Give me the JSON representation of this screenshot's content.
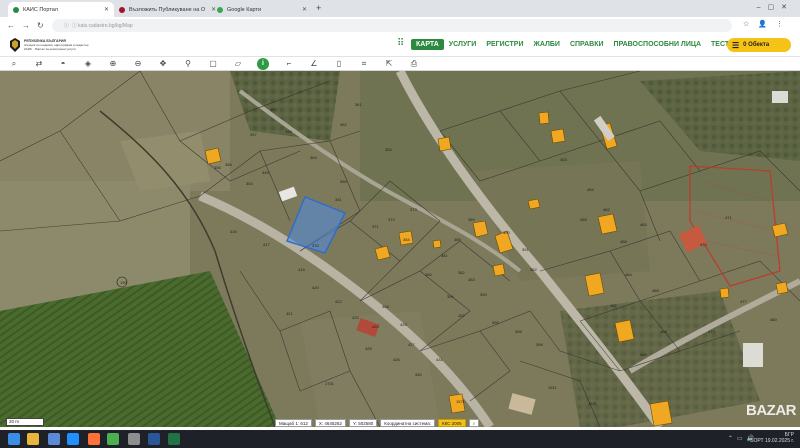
{
  "browser": {
    "tabs": [
      {
        "label": "КАИС Портал",
        "active": true
      },
      {
        "label": "Възложить Публикуване на О",
        "active": false
      },
      {
        "label": "Google Карти",
        "active": false
      }
    ]
  },
  "header": {
    "logo_line1": "РЕПУБЛИКА БЪЛГАРИЯ",
    "logo_line2": "Агенция по геодезия, картография и кадастър",
    "logo_line3": "КАИС - Портал за електронни услуги",
    "nav": [
      "КАРТА",
      "УСЛУГИ",
      "РЕГИСТРИ",
      "ЖАЛБИ",
      "СПРАВКИ",
      "ПРАВОСПОСОБНИ ЛИЦА",
      "ТЕСТ"
    ],
    "objects_label": "0 Обекта"
  },
  "toolbar": {
    "tools": [
      "search-icon",
      "layers-switch-icon",
      "hat-icon",
      "layers-icon",
      "zoom-in-icon",
      "zoom-out-icon",
      "pan-icon",
      "pin-icon",
      "select-rect-icon",
      "select-poly-icon",
      "info-icon",
      "measure-angle-icon",
      "measure-line-icon",
      "book-icon",
      "crop-icon",
      "share-icon",
      "print-icon"
    ]
  },
  "map": {
    "parcel_numbers": [
      "361",
      "362",
      "363",
      "359",
      "357",
      "356",
      "355",
      "354",
      "353",
      "352",
      "351",
      "350",
      "345",
      "370",
      "371",
      "372",
      "373",
      "380",
      "381",
      "382",
      "383",
      "384",
      "385",
      "389",
      "390",
      "391",
      "392",
      "393",
      "394",
      "395",
      "396",
      "398",
      "416",
      "417",
      "418",
      "420",
      "421",
      "422",
      "423",
      "424",
      "425",
      "426",
      "427",
      "428",
      "429",
      "430",
      "431",
      "452",
      "453",
      "454",
      "455",
      "456",
      "462",
      "463",
      "464",
      "465",
      "466",
      "467",
      "468",
      "470",
      "471",
      "473",
      "477",
      "480",
      "190",
      "1701",
      "1571",
      "1511",
      "1521"
    ]
  },
  "footer": {
    "scale_label": "20 m",
    "scale_text": "Мащаб 1:",
    "scale_value": "612",
    "x_label": "X:",
    "x_value": "4645262",
    "y_label": "Y:",
    "y_value": "502580",
    "crs_label": "Координатна система:",
    "crs_value": "ККС 2005"
  },
  "taskbar": {
    "lang": "БГР",
    "lang2": "БОРТ",
    "time": "19.02.2025 г."
  },
  "watermark": "BAZAR"
}
